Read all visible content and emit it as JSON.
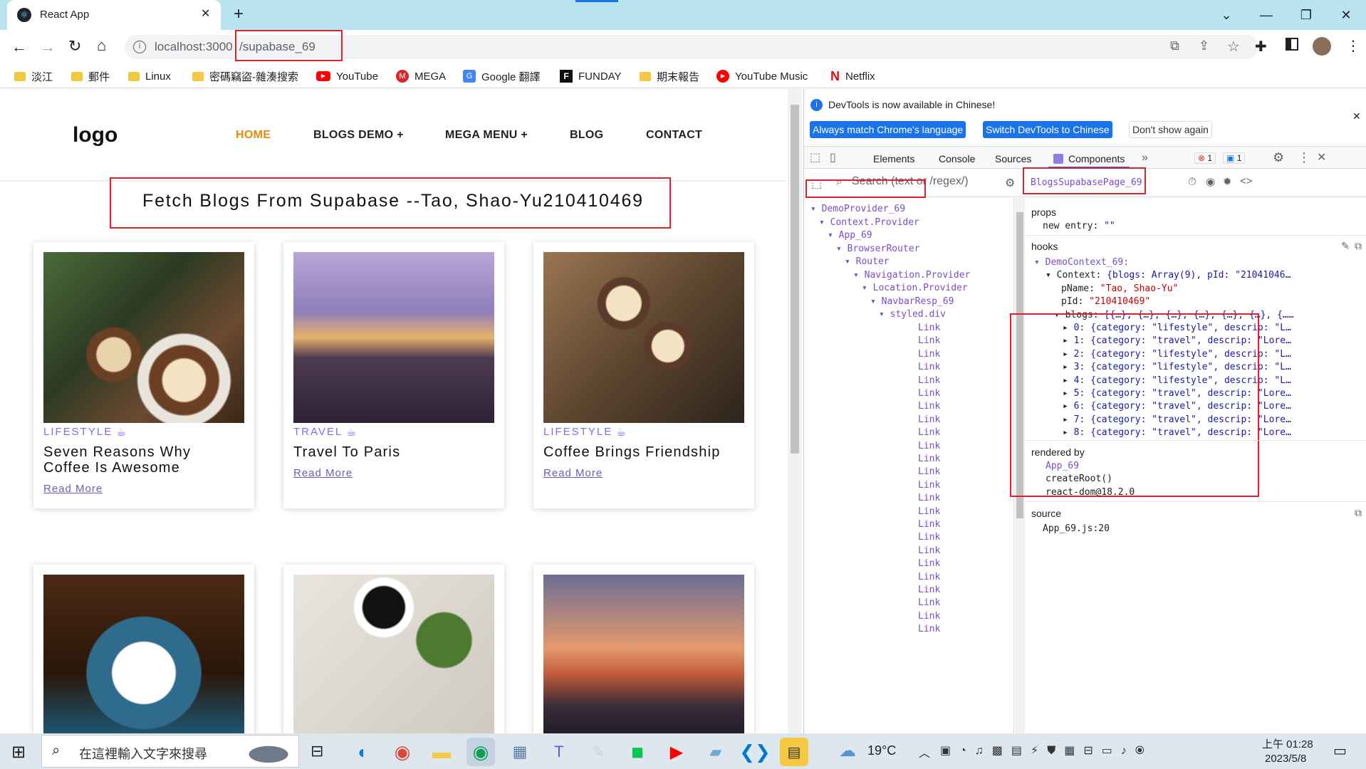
{
  "browser": {
    "tab_title": "React App",
    "url_host": "localhost:3000",
    "url_path": "/supabase_69",
    "bookmarks": [
      {
        "label": "淡江",
        "icon": "folder-icon",
        "color": "#f5c842"
      },
      {
        "label": "郵件",
        "icon": "folder-icon",
        "color": "#f5c842"
      },
      {
        "label": "Linux",
        "icon": "folder-icon",
        "color": "#f5c842"
      },
      {
        "label": "密碼竊盜-雜湊搜索",
        "icon": "folder-icon",
        "color": "#f5c842"
      },
      {
        "label": "YouTube",
        "icon": "youtube-icon",
        "color": "#ff0000"
      },
      {
        "label": "MEGA",
        "icon": "mega-icon",
        "color": "#d9272e"
      },
      {
        "label": "Google 翻譯",
        "icon": "google-translate-icon",
        "color": "#4285f4"
      },
      {
        "label": "FUNDAY",
        "icon": "funday-icon",
        "color": "#111111"
      },
      {
        "label": "期末報告",
        "icon": "folder-icon",
        "color": "#f5c842"
      },
      {
        "label": "YouTube Music",
        "icon": "youtube-music-icon",
        "color": "#ff0000"
      },
      {
        "label": "Netflix",
        "icon": "netflix-icon",
        "color": "#e50914"
      }
    ]
  },
  "site": {
    "logo": "logo",
    "nav": [
      "HOME",
      "BLOGS DEMO +",
      "MEGA MENU +",
      "BLOG",
      "CONTACT"
    ],
    "active_color": "#e8890c",
    "heading": "Fetch Blogs From Supabase --Tao, Shao-Yu210410469",
    "cards": [
      {
        "category": "LIFESTYLE",
        "title_line1": "Seven Reasons Why",
        "title_line2": "Coffee Is Awesome",
        "link": "Read More"
      },
      {
        "category": "TRAVEL",
        "title_line1": "Travel To Paris",
        "title_line2": "",
        "link": "Read More"
      },
      {
        "category": "LIFESTYLE",
        "title_line1": "Coffee Brings Friendship",
        "title_line2": "",
        "link": "Read More"
      }
    ]
  },
  "devtools": {
    "banner": "DevTools is now available in Chinese!",
    "btn_match": "Always match Chrome's language",
    "btn_switch": "Switch DevTools to Chinese",
    "btn_dont": "Don't show again",
    "tabs": [
      "Elements",
      "Console",
      "Sources",
      "Components"
    ],
    "error_count": "1",
    "message_count": "1",
    "search_placeholder": "Search (text or /regex/)",
    "selected_component": "BlogsSupabasePage_69",
    "tree": [
      "DemoProvider_69",
      "Context.Provider",
      "App_69",
      "BrowserRouter",
      "Router",
      "Navigation.Provider",
      "Location.Provider",
      "NavbarResp_69",
      "styled.div"
    ],
    "link_label": "Link",
    "props_label": "props",
    "prop_key": "new entry:",
    "prop_val": "\"\"",
    "hooks_label": "hooks",
    "hook_name": "DemoContext_69:",
    "context_key": "Context:",
    "context_val": "{blogs: Array(9), pId: \"21041046…",
    "pname_key": "pName:",
    "pname_val": "\"Tao, Shao-Yu\"",
    "pid_key": "pId:",
    "pid_val": "\"210410469\"",
    "blogs_key": "blogs:",
    "blogs_val": "[{…}, {…}, {…}, {…}, {…}, {…}, {……",
    "blog_items": [
      "0: {category: \"lifestyle\", descrip: \"L…",
      "1: {category: \"travel\", descrip: \"Lore…",
      "2: {category: \"lifestyle\", descrip: \"L…",
      "3: {category: \"lifestyle\", descrip: \"L…",
      "4: {category: \"lifestyle\", descrip: \"L…",
      "5: {category: \"travel\", descrip: \"Lore…",
      "6: {category: \"travel\", descrip: \"Lore…",
      "7: {category: \"travel\", descrip: \"Lore…",
      "8: {category: \"travel\", descrip: \"Lore…"
    ],
    "rendered_by_label": "rendered by",
    "rendered_by": [
      "App_69",
      "createRoot()",
      "react-dom@18.2.0"
    ],
    "source_label": "source",
    "source_file": "App_69.js:20"
  },
  "taskbar": {
    "search_placeholder": "在這裡輸入文字來搜尋",
    "temperature": "19°C",
    "time": "上午 01:28",
    "date": "2023/5/8"
  }
}
